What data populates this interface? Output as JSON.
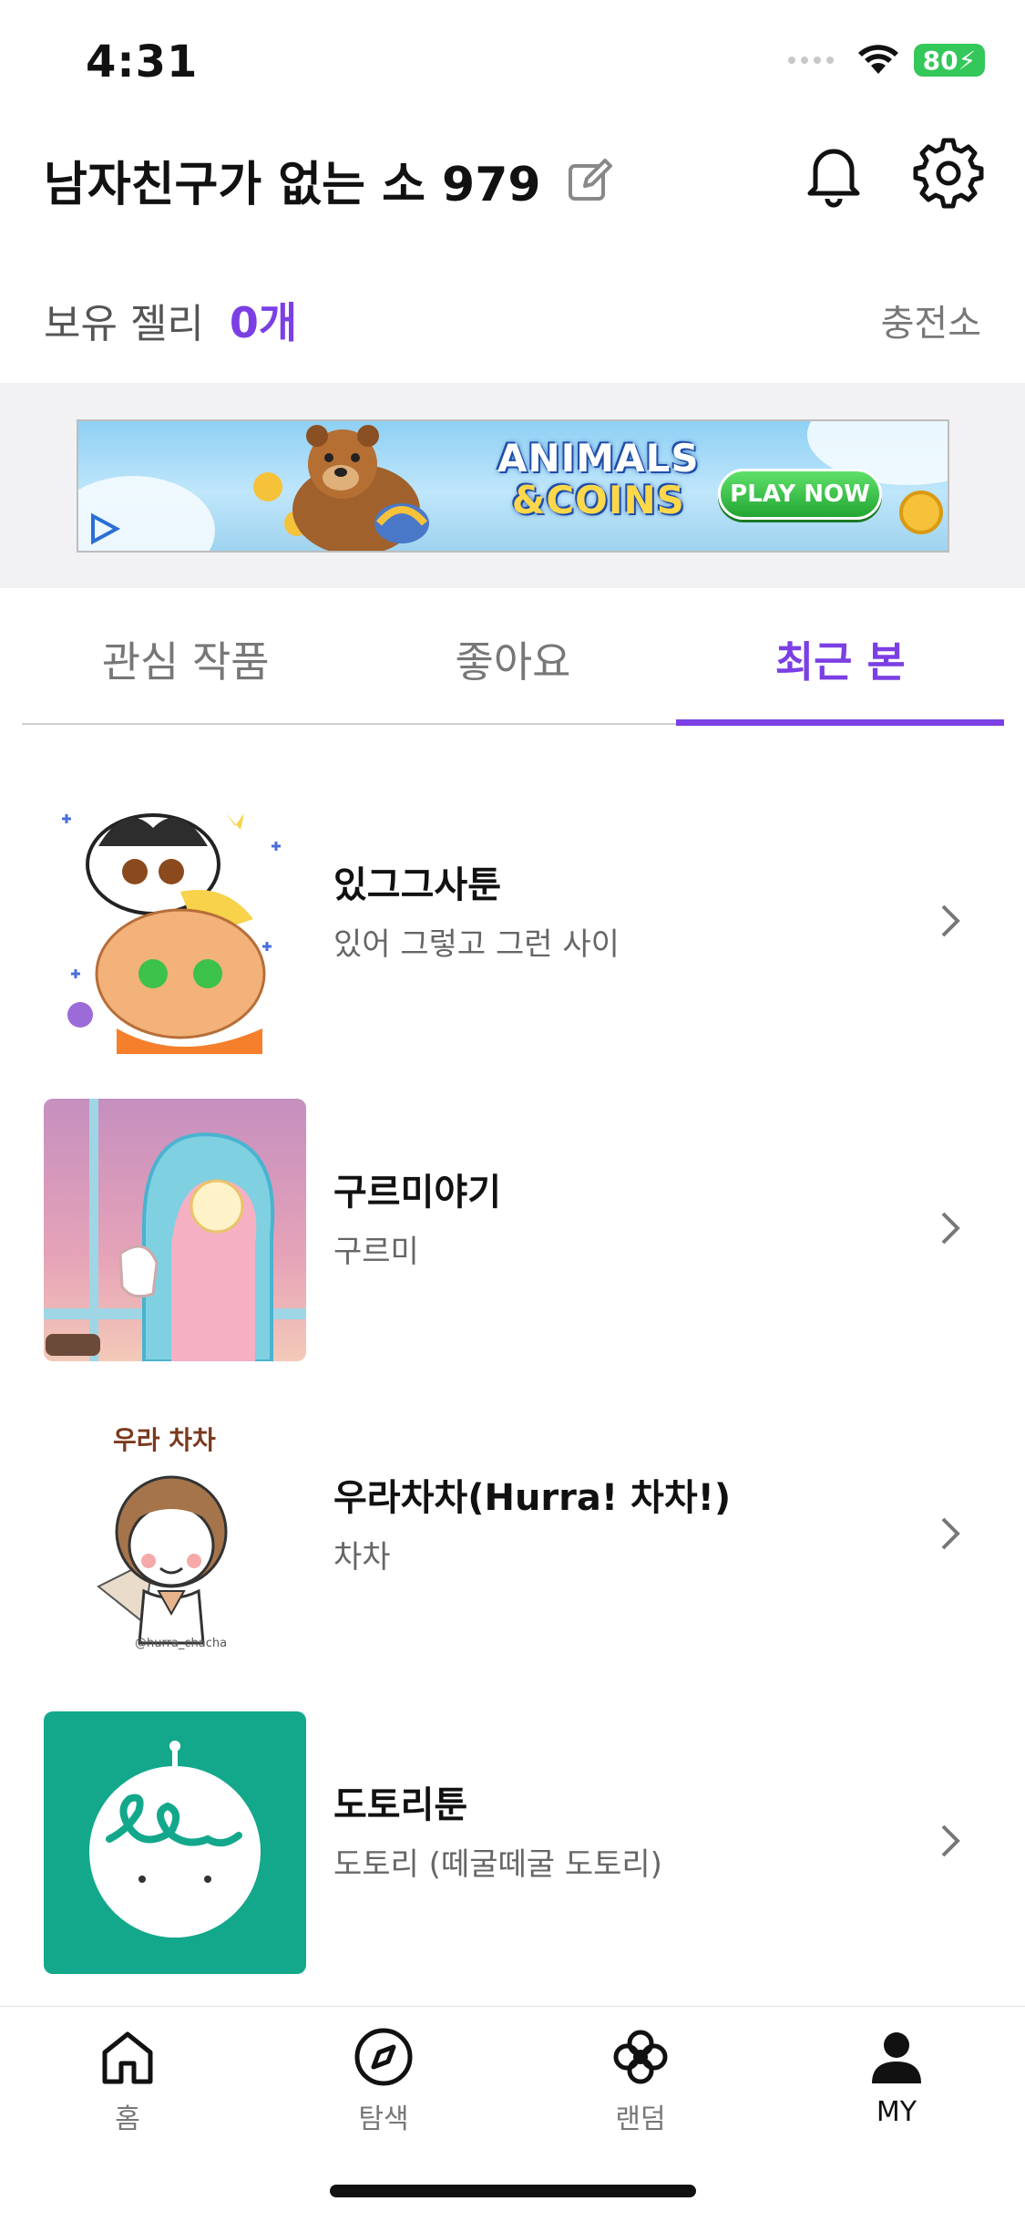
{
  "status_bar": {
    "time": "4:31",
    "battery": "80"
  },
  "header": {
    "username": "남자친구가 없는 소 979"
  },
  "jelly": {
    "label": "보유 젤리",
    "count": "0개",
    "charge_label": "충전소"
  },
  "ad": {
    "title_line1": "ANIMALS",
    "title_line2": "&COINS",
    "button_label": "PLAY NOW"
  },
  "tabs": [
    {
      "label": "관심 작품"
    },
    {
      "label": "좋아요"
    },
    {
      "label": "최근 본"
    }
  ],
  "recent_items": [
    {
      "title": "있그그사툰",
      "author": "있어 그렇고 그런 사이"
    },
    {
      "title": "구르미야기",
      "author": "구르미"
    },
    {
      "title": "우라차차(Hurra! 차차!)",
      "author": "차차",
      "thumb_text": "우라 차차",
      "thumb_handle": "@hurra_chacha"
    },
    {
      "title": "도토리툰",
      "author": "도토리 (떼굴떼굴 도토리)"
    }
  ],
  "bottom_nav": [
    {
      "label": "홈",
      "icon": "home-icon"
    },
    {
      "label": "탐색",
      "icon": "compass-icon"
    },
    {
      "label": "랜덤",
      "icon": "clover-icon"
    },
    {
      "label": "MY",
      "icon": "person-icon"
    }
  ],
  "colors": {
    "accent": "#7b3fe4",
    "thumb_green": "#13a88c"
  }
}
